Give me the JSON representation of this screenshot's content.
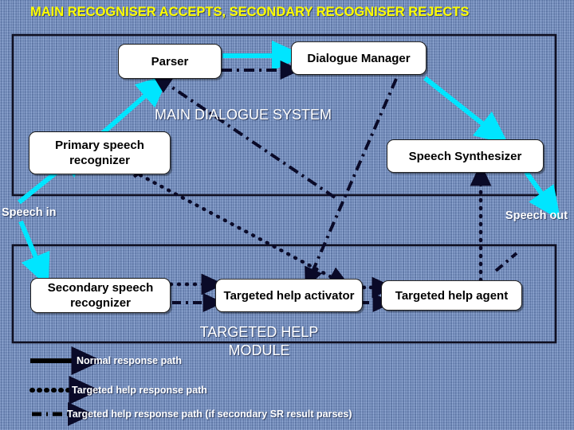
{
  "slide": {
    "title": "MAIN RECOGNISER ACCEPTS, SECONDARY RECOGNISER REJECTS",
    "background_color": "#6f8fc9",
    "title_color": "#ffff00",
    "accent_color": "#00e5ff"
  },
  "groups": {
    "main_system": "MAIN DIALOGUE\nSYSTEM",
    "targeted_help": "TARGETED HELP\nMODULE"
  },
  "nodes": {
    "parser": "Parser",
    "dialogue_manager": "Dialogue Manager",
    "primary_sr": "Primary speech\nrecognizer",
    "speech_synthesizer": "Speech Synthesizer",
    "secondary_sr": "Secondary speech\nrecognizer",
    "help_activator": "Targeted help\nactivator",
    "help_agent": "Targeted help agent"
  },
  "io": {
    "speech_in": "Speech in",
    "speech_out": "Speech\nout"
  },
  "legend": {
    "items": [
      {
        "label": "Normal response path",
        "style": "solid",
        "color": "#000000"
      },
      {
        "label": "Targeted help response path",
        "style": "dotted",
        "color": "#000000"
      },
      {
        "label": "Targeted help response path (if secondary SR result parses)",
        "style": "dash-dot",
        "color": "#000000"
      }
    ]
  }
}
